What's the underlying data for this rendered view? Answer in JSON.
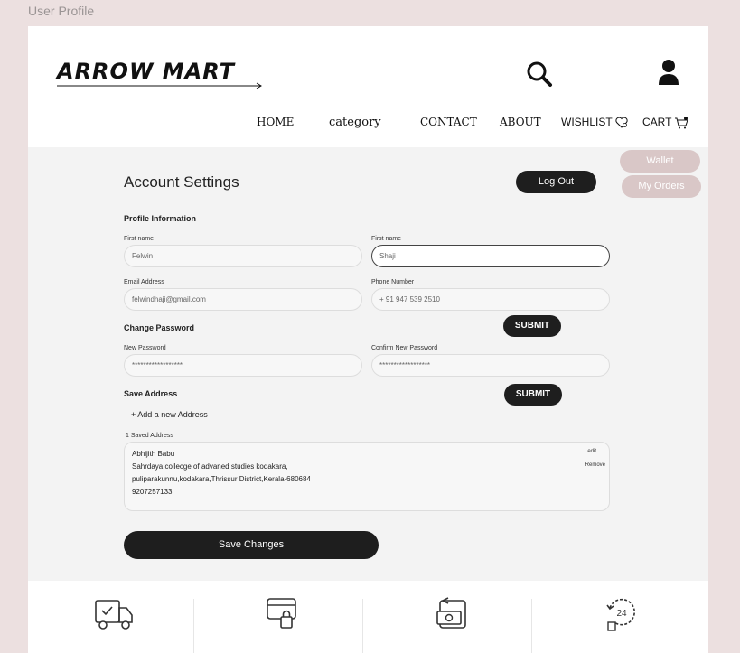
{
  "frame_label": "User Profile",
  "header": {
    "logo": "ARROW MART",
    "nav": {
      "home": "HOME",
      "category": "category",
      "contact": "CONTACT",
      "about": "ABOUT",
      "wishlist": "WISHLIST",
      "cart": "CART"
    }
  },
  "side_menu": {
    "wallet": "Wallet",
    "orders": "My Orders"
  },
  "account": {
    "title": "Account Settings",
    "logout": "Log Out",
    "profile_section": "Profile Information",
    "first_name_label": "First name",
    "first_name_value": "Felwin",
    "last_name_label": "First name",
    "last_name_value": "Shaji",
    "email_label": "Email Address",
    "email_value": "felwindhaji@gmail.com",
    "phone_label": "Phone Number",
    "phone_value": "+ 91  947 539 2510",
    "submit_label": "SUBMIT",
    "password_section": "Change Password",
    "new_password_label": "New Password",
    "new_password_value": "******************",
    "confirm_password_label": "Confirm New Password",
    "confirm_password_value": "******************",
    "submit_label_2": "SUBMIT",
    "address_section": "Save Address",
    "add_address": "+ Add a new Address",
    "saved_count_label": "1 Saved Address",
    "address": {
      "name": "Abhijith Babu",
      "line1": "Sahrdaya collecge of advaned studies kodakara,",
      "line2": "pulipara­kunnu,kodakara,Thrissur District,Kerala-680684",
      "phone": "9207257133",
      "edit": "edit",
      "remove": "Remove"
    },
    "save_changes": "Save Changes"
  },
  "footer": {
    "icons": [
      "delivery-truck-icon",
      "secure-card-icon",
      "cash-return-icon",
      "support-24-icon"
    ]
  }
}
